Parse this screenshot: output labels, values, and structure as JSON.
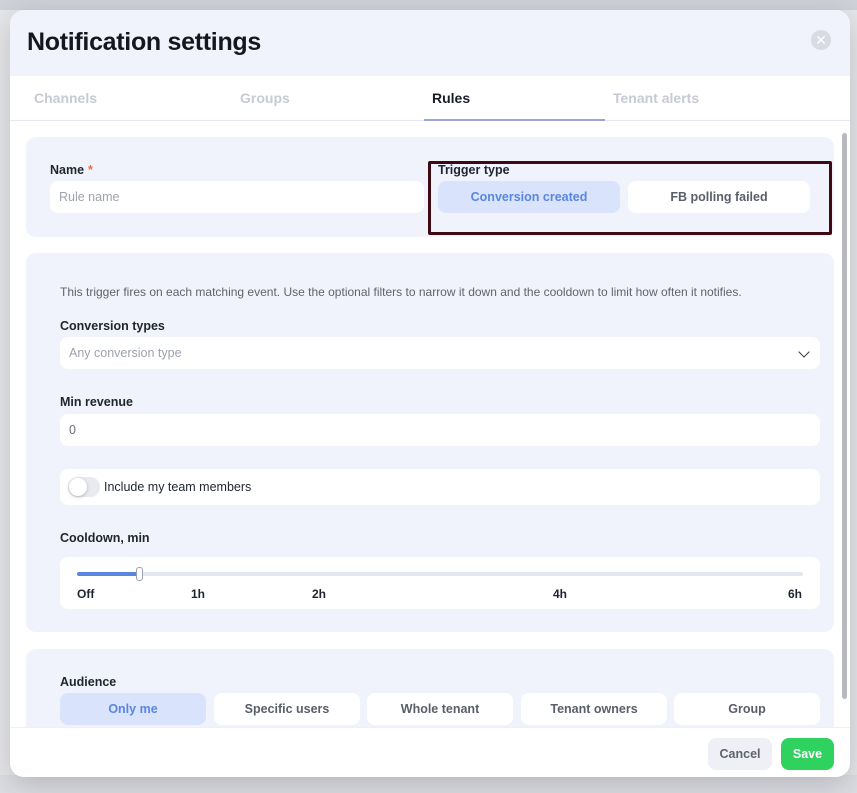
{
  "modal": {
    "title": "Notification settings",
    "close_icon": "close-icon"
  },
  "tabs": [
    {
      "label": "Channels",
      "active": false
    },
    {
      "label": "Groups",
      "active": false
    },
    {
      "label": "Rules",
      "active": true
    },
    {
      "label": "Tenant alerts",
      "active": false
    }
  ],
  "rule_form": {
    "name_label": "Name",
    "required_mark": "*",
    "name_placeholder": "Rule name",
    "trigger_type_label": "Trigger type",
    "trigger_options": [
      {
        "label": "Conversion created",
        "selected": true
      },
      {
        "label": "FB polling failed",
        "selected": false
      }
    ],
    "description": "This trigger fires on each matching event. Use the optional filters to narrow it down and the cooldown to limit how often it notifies.",
    "conversion_types_label": "Conversion types",
    "conversion_types_placeholder": "Any conversion type",
    "min_revenue_label": "Min revenue",
    "min_revenue_value": "0",
    "include_team_label": "Include my team members",
    "include_team_enabled": false,
    "cooldown_label": "Cooldown, min",
    "cooldown_ticks": [
      "Off",
      "1h",
      "2h",
      "4h",
      "6h"
    ],
    "cooldown_value_fraction": 0.085
  },
  "audience": {
    "label": "Audience",
    "options": [
      {
        "label": "Only me",
        "selected": true
      },
      {
        "label": "Specific users",
        "selected": false
      },
      {
        "label": "Whole tenant",
        "selected": false
      },
      {
        "label": "Tenant owners",
        "selected": false
      },
      {
        "label": "Group",
        "selected": false
      }
    ]
  },
  "footer": {
    "cancel_label": "Cancel",
    "save_label": "Save"
  },
  "colors": {
    "accent": "#5a86e0",
    "save": "#2fd15f",
    "required": "#f06a4a",
    "highlight_border": "#3d0a14"
  }
}
